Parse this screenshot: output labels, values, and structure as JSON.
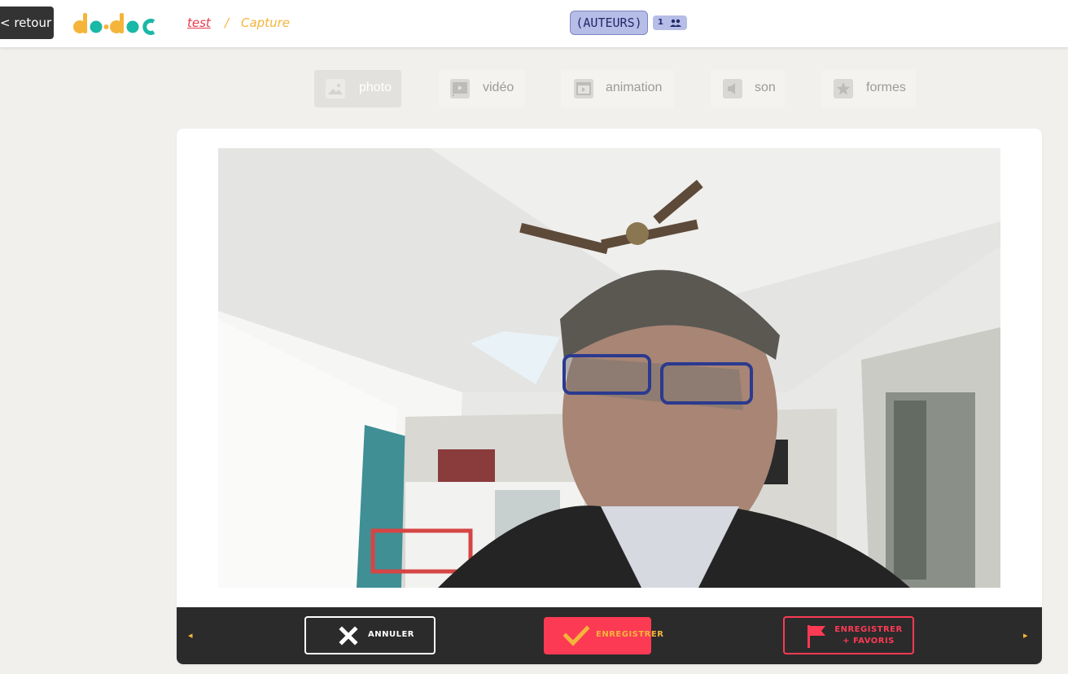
{
  "header": {
    "back_label": "< retour",
    "logo_alt": "do•doc",
    "breadcrumb": {
      "project": "test",
      "separator": "/",
      "page": "Capture"
    },
    "authors_label": "(AUTEURS)",
    "authors_count": "1"
  },
  "modes": [
    {
      "label": "photo",
      "icon": "image-icon",
      "active": true
    },
    {
      "label": "vidéo",
      "icon": "video-icon",
      "active": false
    },
    {
      "label": "animation",
      "icon": "animation-icon",
      "active": false
    },
    {
      "label": "son",
      "icon": "sound-icon",
      "active": false
    },
    {
      "label": "formes",
      "icon": "star-icon",
      "active": false
    }
  ],
  "actions": {
    "prev_arrow": "◂",
    "next_arrow": "▸",
    "cancel_label": "ANNULER",
    "save_label": "ENREGISTRER",
    "save_fav_line1": "ENREGISTRER",
    "save_fav_line2": "+ FAVORIS"
  },
  "colors": {
    "accent_red": "#fc3a54",
    "accent_yellow": "#f4b53a",
    "logo_teal": "#1ab8a6",
    "authors_bg": "#b6bde6"
  }
}
